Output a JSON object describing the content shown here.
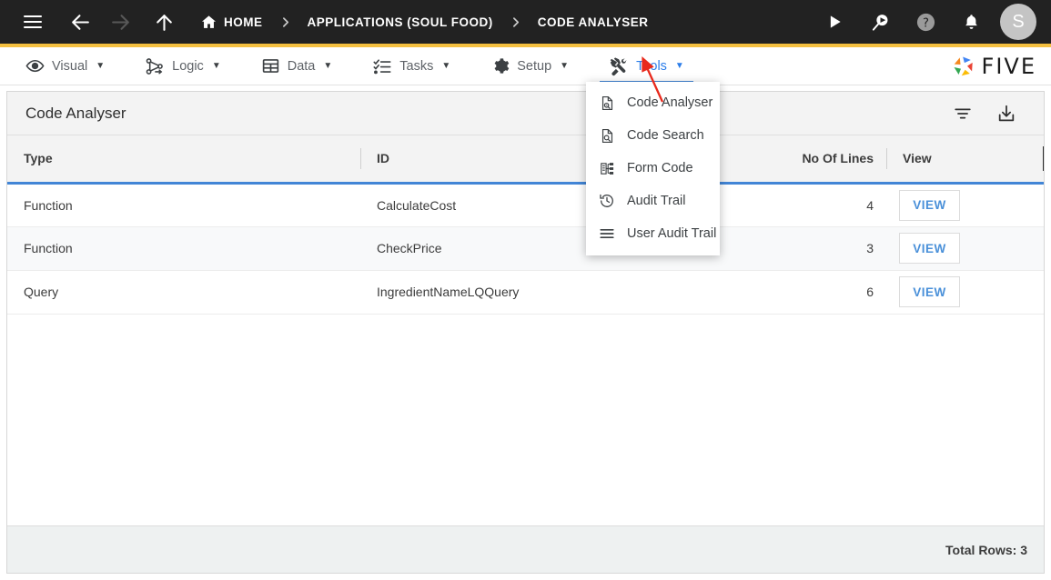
{
  "topbar": {
    "menu_icon": "hamburger-menu-icon",
    "back_icon": "arrow-left-icon",
    "forward_icon": "arrow-right-icon",
    "up_icon": "arrow-up-icon",
    "home_icon": "home-icon",
    "breadcrumbs": [
      {
        "label": "HOME"
      },
      {
        "label": "APPLICATIONS (SOUL FOOD)"
      },
      {
        "label": "CODE ANALYSER"
      }
    ],
    "actions": [
      {
        "name": "run-icon",
        "label": "Run"
      },
      {
        "name": "debug-search-icon",
        "label": "Debug"
      },
      {
        "name": "help-icon",
        "label": "Help"
      },
      {
        "name": "notifications-bell-icon",
        "label": "Notifications"
      }
    ],
    "avatar_initial": "S",
    "accent_color": "#F5C040",
    "background_color": "#222222"
  },
  "menubar": {
    "items": [
      {
        "label": "Visual",
        "icon": "eye-icon",
        "caret": "▼",
        "active": false
      },
      {
        "label": "Logic",
        "icon": "logic-nodes-icon",
        "caret": "▼",
        "active": false
      },
      {
        "label": "Data",
        "icon": "table-grid-icon",
        "caret": "▼",
        "active": false
      },
      {
        "label": "Tasks",
        "icon": "checklist-icon",
        "caret": "▼",
        "active": false
      },
      {
        "label": "Setup",
        "icon": "gear-icon",
        "caret": "▼",
        "active": false
      },
      {
        "label": "Tools",
        "icon": "tools-wrench-icon",
        "caret": "▼",
        "active": true
      }
    ],
    "brand": "FIVE",
    "active_color": "#2b7de9"
  },
  "dropdown": {
    "open_for": "Tools",
    "items": [
      {
        "label": "Code Analyser",
        "icon": "document-analyse-icon"
      },
      {
        "label": "Code Search",
        "icon": "document-search-icon"
      },
      {
        "label": "Form Code",
        "icon": "form-code-icon"
      },
      {
        "label": "Audit Trail",
        "icon": "history-clock-icon"
      },
      {
        "label": "User Audit Trail",
        "icon": "list-lines-icon"
      }
    ]
  },
  "panel": {
    "title": "Code Analyser",
    "tools": [
      {
        "name": "filter-icon",
        "label": "Filter"
      },
      {
        "name": "download-icon",
        "label": "Download"
      }
    ]
  },
  "table": {
    "columns": [
      {
        "key": "type",
        "label": "Type",
        "align": "left"
      },
      {
        "key": "id",
        "label": "ID",
        "align": "left"
      },
      {
        "key": "lines",
        "label": "No Of Lines",
        "align": "right"
      },
      {
        "key": "view",
        "label": "View",
        "align": "left"
      }
    ],
    "rows": [
      {
        "type": "Function",
        "id": "CalculateCost",
        "lines": "4",
        "view": "VIEW"
      },
      {
        "type": "Function",
        "id": "CheckPrice",
        "lines": "3",
        "view": "VIEW"
      },
      {
        "type": "Query",
        "id": "IngredientNameLQQuery",
        "lines": "6",
        "view": "VIEW"
      }
    ],
    "header_underline_color": "#4285d6"
  },
  "footer": {
    "total_rows_label": "Total Rows: 3"
  },
  "annotation": {
    "arrow_color": "#e8291c",
    "points_to": "tools-dropdown-caret"
  }
}
